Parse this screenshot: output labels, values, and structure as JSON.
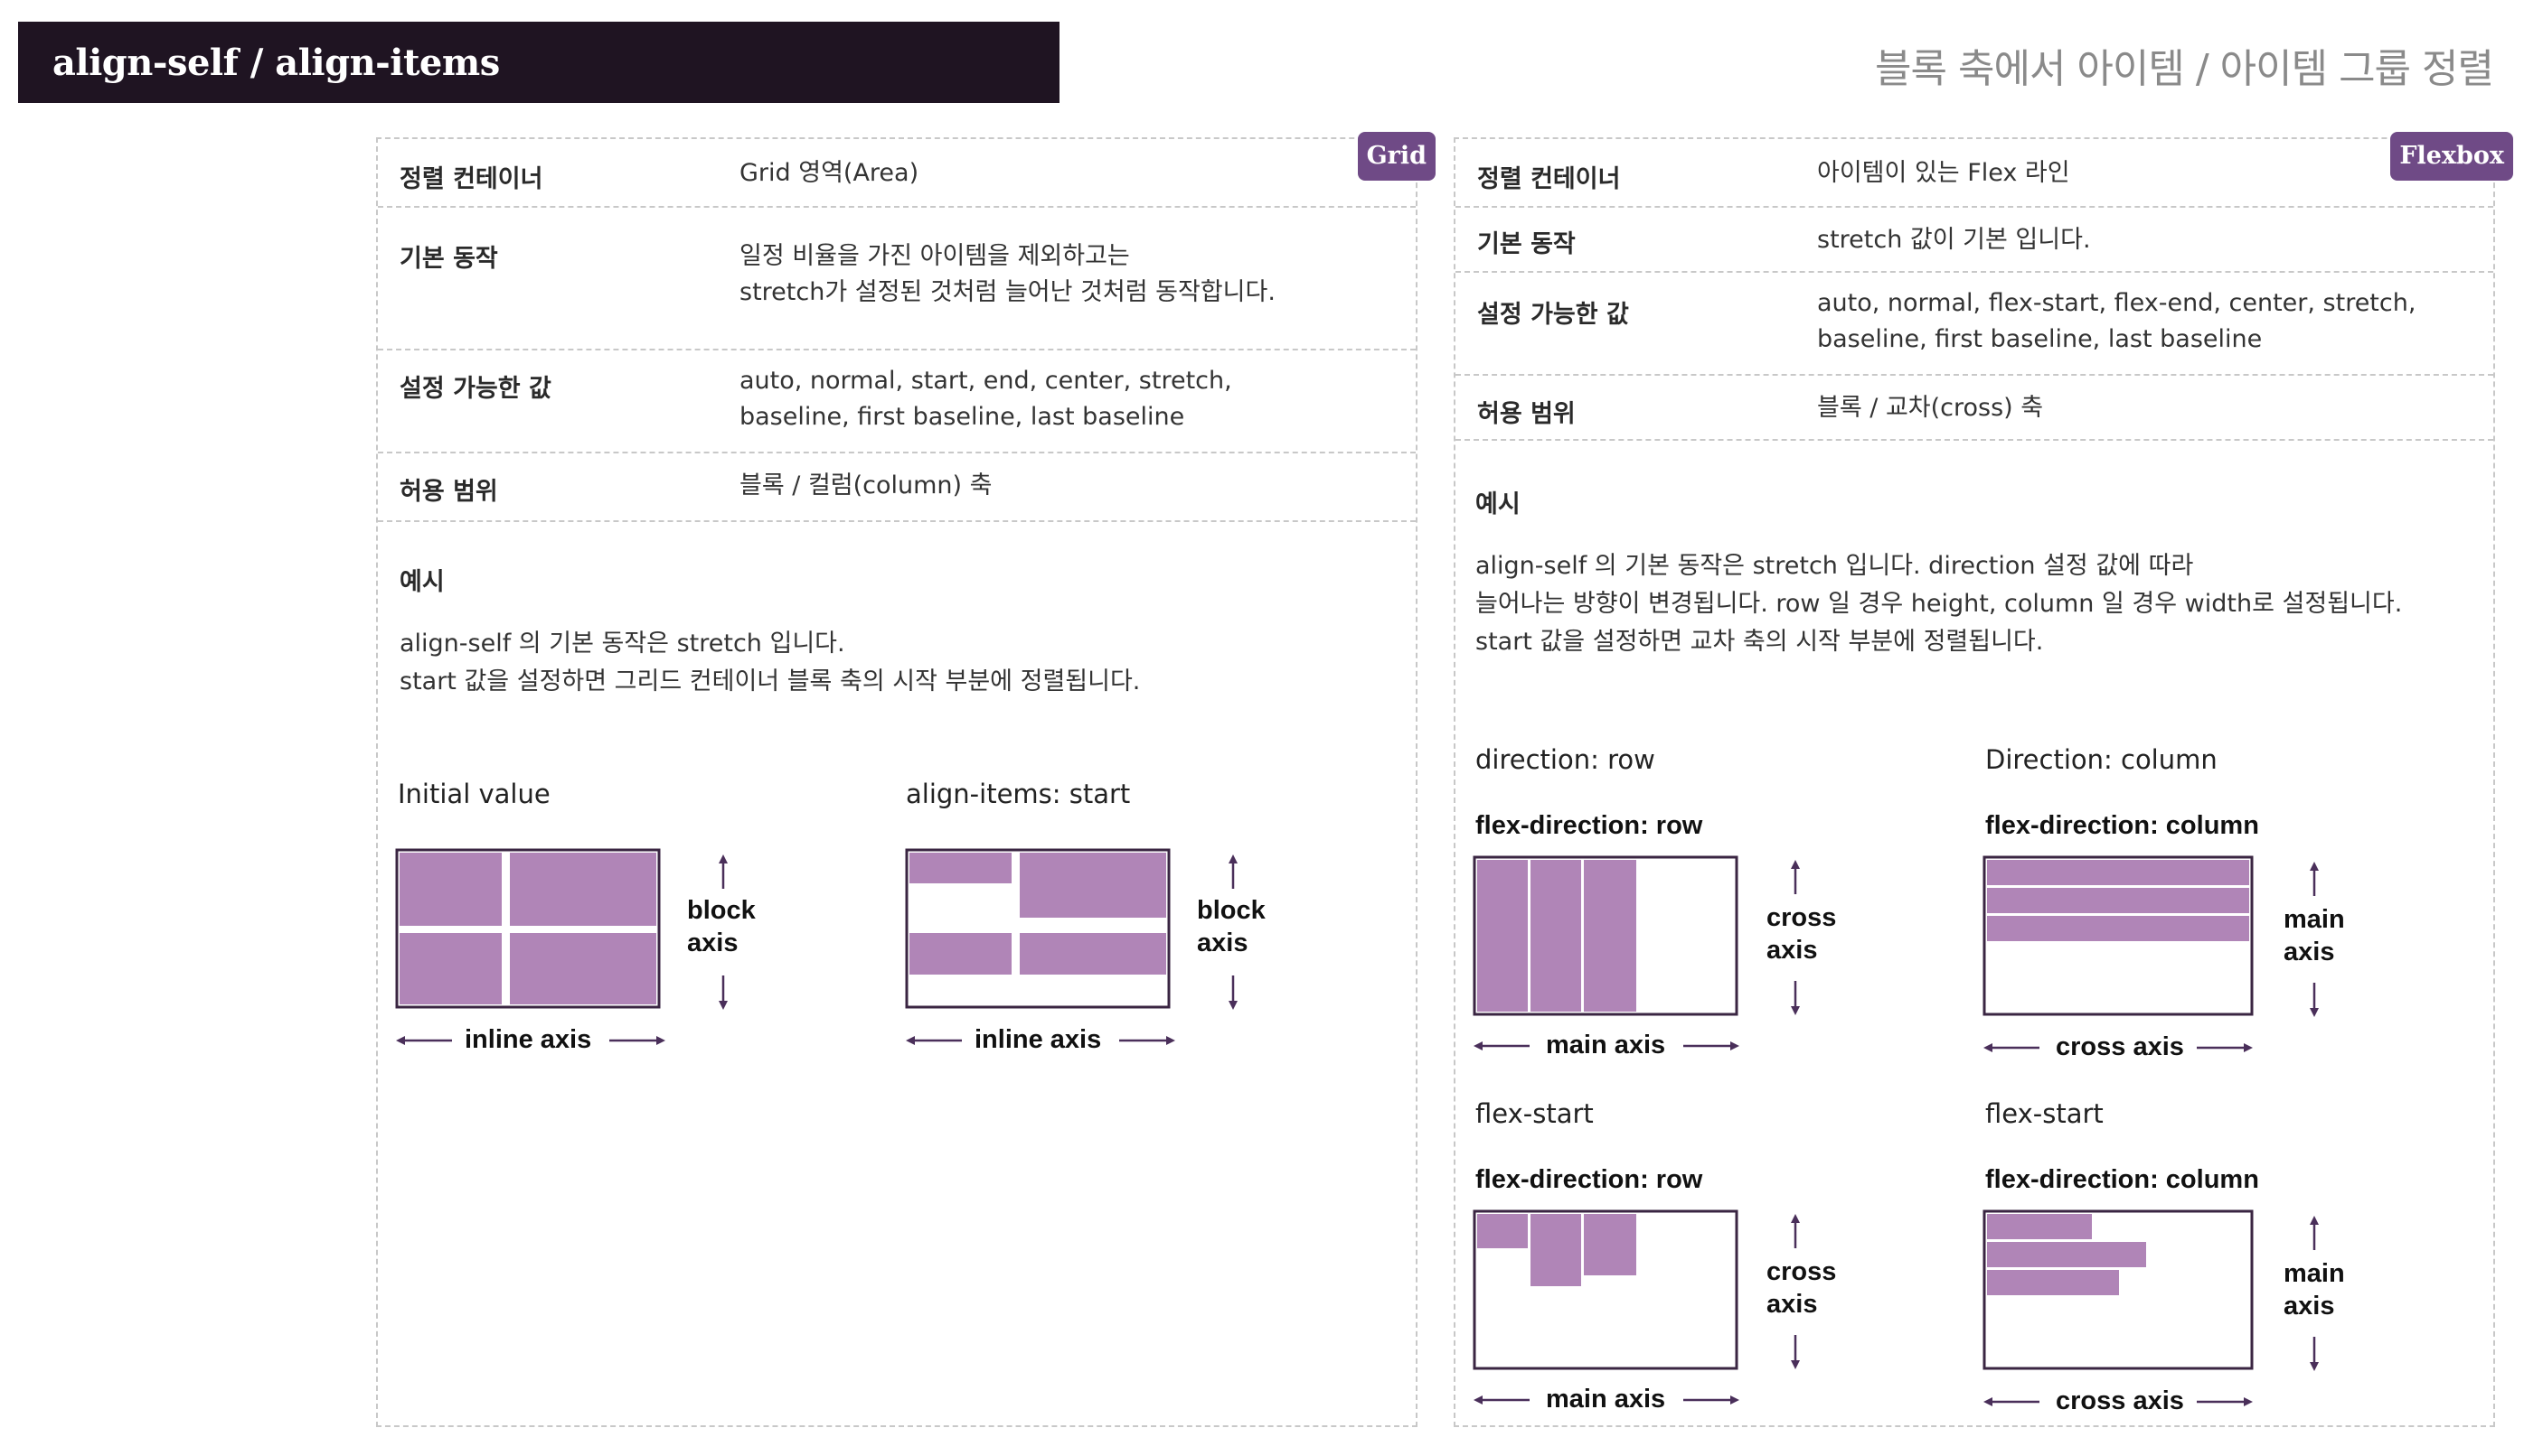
{
  "header": {
    "title": "align-self / align-items",
    "subtitle": "블록 축에서 아이템 / 아이템 그룹 정렬"
  },
  "colors": {
    "header_bg": "#1f1422",
    "tag_bg": "#6f4a86",
    "item_fill": "#b085b7",
    "arrow": "#4a2f5a"
  },
  "grid_panel": {
    "tag": "Grid",
    "rows": [
      {
        "key": "정렬 컨테이너",
        "value": [
          "Grid 영역(Area)"
        ]
      },
      {
        "key": "기본 동작",
        "value": [
          "일정 비율을 가진 아이템을 제외하고는",
          "stretch가 설정된 것처럼 늘어난 것처럼 동작합니다."
        ]
      },
      {
        "key": "설정 가능한 값",
        "value": [
          "auto, normal, start, end, center, stretch,",
          "baseline, first baseline, last baseline"
        ]
      },
      {
        "key": "허용 범위",
        "value": [
          "블록 / 컬럼(column) 축"
        ]
      }
    ],
    "example_head": "예시",
    "example_text": [
      "align-self 의 기본 동작은 stretch 입니다.",
      "start 값을 설정하면 그리드 컨테이너 블록 축의 시작 부분에 정렬됩니다."
    ],
    "diagrams": [
      {
        "title": "Initial value",
        "side_label": [
          "block",
          "axis"
        ],
        "bottom_label": "inline axis"
      },
      {
        "title": "align-items: start",
        "side_label": [
          "block",
          "axis"
        ],
        "bottom_label": "inline axis"
      }
    ]
  },
  "flex_panel": {
    "tag": "Flexbox",
    "rows": [
      {
        "key": "정렬 컨테이너",
        "value": [
          "아이템이 있는 Flex 라인"
        ]
      },
      {
        "key": "기본 동작",
        "value": [
          "stretch 값이 기본 입니다."
        ]
      },
      {
        "key": "설정 가능한 값",
        "value": [
          "auto, normal, flex-start, flex-end, center, stretch,",
          "baseline, first baseline, last baseline"
        ]
      },
      {
        "key": "허용 범위",
        "value": [
          "블록 / 교차(cross) 축"
        ]
      }
    ],
    "example_head": "예시",
    "example_text": [
      "align-self 의 기본 동작은 stretch 입니다. direction 설정 값에 따라",
      "늘어나는 방향이 변경됩니다. row 일 경우 height, column 일 경우 width로 설정됩니다.",
      "start 값을 설정하면 교차 축의 시작 부분에 정렬됩니다."
    ],
    "col_titles": [
      "direction: row",
      "Direction: column"
    ],
    "diagrams": [
      {
        "subtitle": "flex-direction: row",
        "side_label": [
          "cross",
          "axis"
        ],
        "bottom_label": "main axis"
      },
      {
        "subtitle": "flex-direction: column",
        "side_label": [
          "main",
          "axis"
        ],
        "bottom_label": "cross axis"
      },
      {
        "caption": "flex-start",
        "subtitle": "flex-direction: row",
        "side_label": [
          "cross",
          "axis"
        ],
        "bottom_label": "main axis"
      },
      {
        "caption": "flex-start",
        "subtitle": "flex-direction: column",
        "side_label": [
          "main",
          "axis"
        ],
        "bottom_label": "cross axis"
      }
    ]
  }
}
